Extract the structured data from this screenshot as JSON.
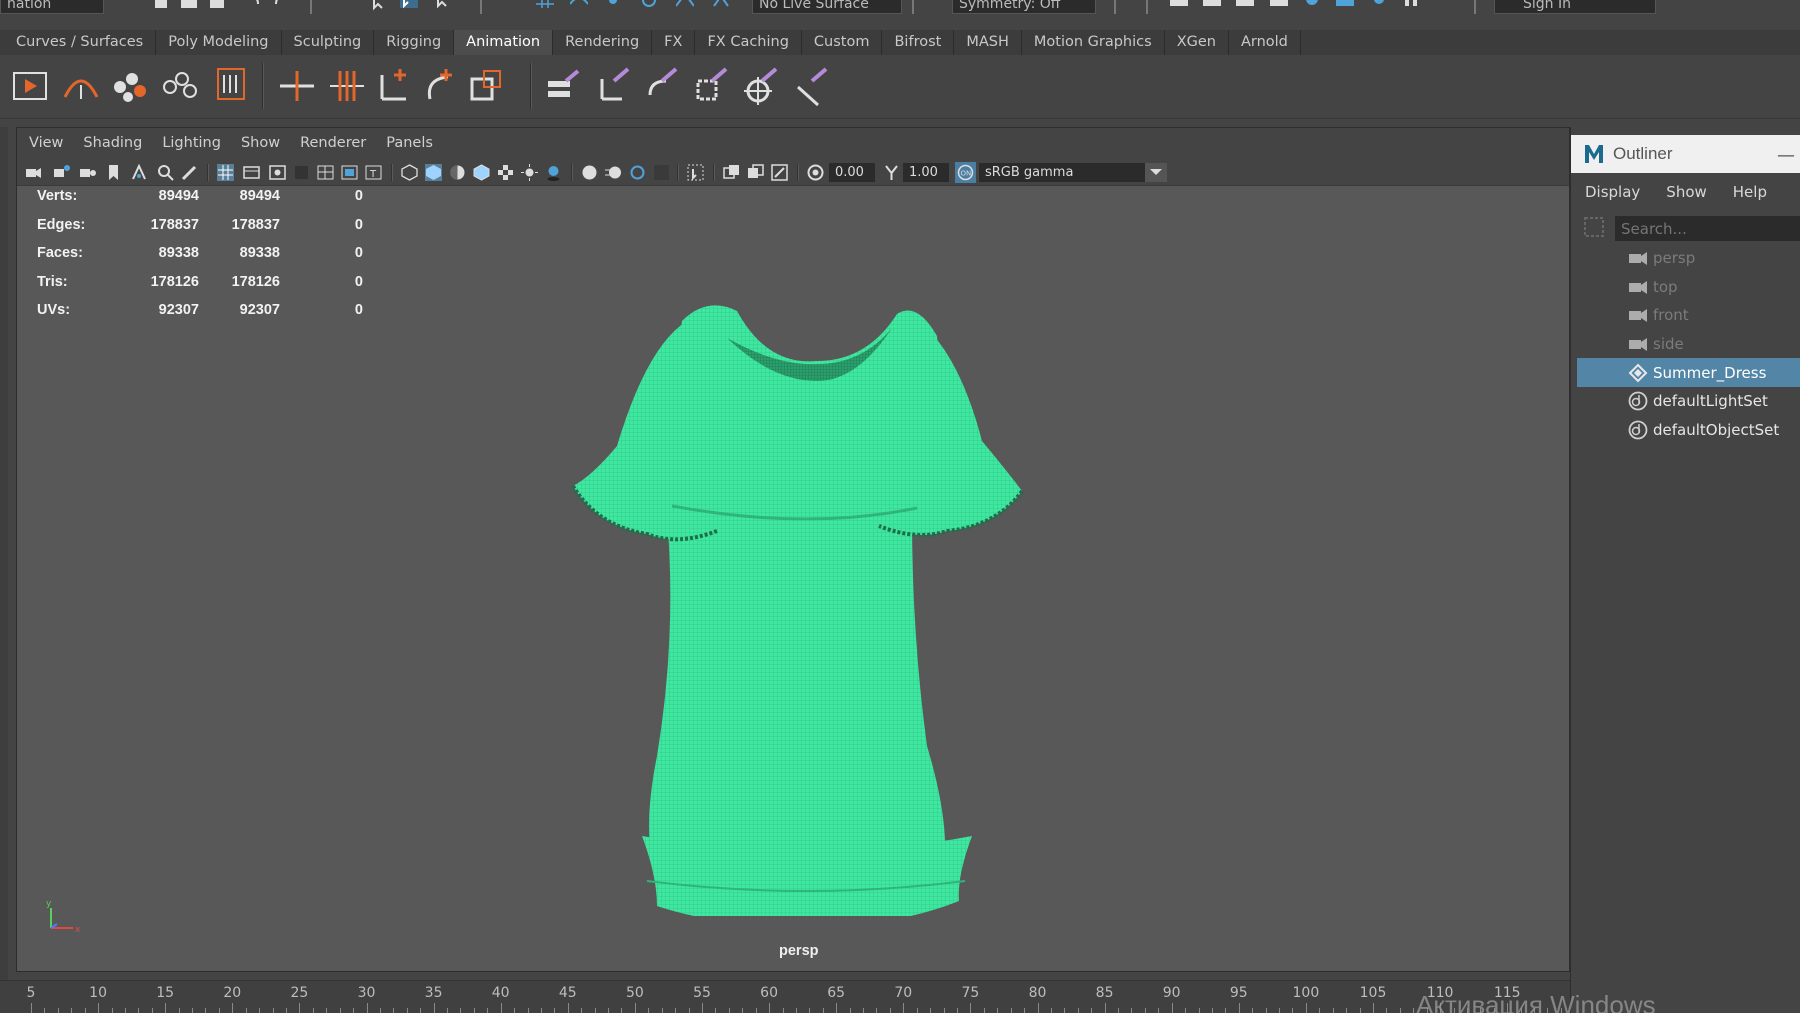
{
  "statusline": {
    "menu_set": "nation",
    "live_surface": "No Live Surface",
    "symmetry": "Symmetry: Off",
    "sign_in": "Sign In"
  },
  "shelf_tabs": [
    {
      "label": "Curves / Surfaces",
      "active": false
    },
    {
      "label": "Poly Modeling",
      "active": false
    },
    {
      "label": "Sculpting",
      "active": false
    },
    {
      "label": "Rigging",
      "active": false
    },
    {
      "label": "Animation",
      "active": true
    },
    {
      "label": "Rendering",
      "active": false
    },
    {
      "label": "FX",
      "active": false
    },
    {
      "label": "FX Caching",
      "active": false
    },
    {
      "label": "Custom",
      "active": false
    },
    {
      "label": "Bifrost",
      "active": false
    },
    {
      "label": "MASH",
      "active": false
    },
    {
      "label": "Motion Graphics",
      "active": false
    },
    {
      "label": "XGen",
      "active": false
    },
    {
      "label": "Arnold",
      "active": false
    }
  ],
  "panel": {
    "menus": [
      "View",
      "Shading",
      "Lighting",
      "Show",
      "Renderer",
      "Panels"
    ],
    "exposure": "0.00",
    "gamma": "1.00",
    "color_space": "sRGB gamma",
    "camera_label": "persp"
  },
  "hud": [
    {
      "label": "Verts:",
      "a": "89494",
      "b": "89494",
      "c": "0"
    },
    {
      "label": "Edges:",
      "a": "178837",
      "b": "178837",
      "c": "0"
    },
    {
      "label": "Faces:",
      "a": "89338",
      "b": "89338",
      "c": "0"
    },
    {
      "label": "Tris:",
      "a": "178126",
      "b": "178126",
      "c": "0"
    },
    {
      "label": "UVs:",
      "a": "92307",
      "b": "92307",
      "c": "0"
    }
  ],
  "timeline": {
    "labels": [
      "5",
      "10",
      "15",
      "20",
      "25",
      "30",
      "35",
      "40",
      "45",
      "50",
      "55",
      "60",
      "65",
      "70",
      "75",
      "80",
      "85",
      "90",
      "95",
      "100",
      "105",
      "110",
      "115"
    ]
  },
  "outliner": {
    "title": "Outliner",
    "menus": [
      "Display",
      "Show",
      "Help"
    ],
    "search_placeholder": "Search...",
    "items": [
      {
        "label": "persp",
        "icon": "camera-icon",
        "state": "dim"
      },
      {
        "label": "top",
        "icon": "camera-icon",
        "state": "dim"
      },
      {
        "label": "front",
        "icon": "camera-icon",
        "state": "dim"
      },
      {
        "label": "side",
        "icon": "camera-icon",
        "state": "dim"
      },
      {
        "label": "Summer_Dress",
        "icon": "transform-icon",
        "state": "selected"
      },
      {
        "label": "defaultLightSet",
        "icon": "set-icon",
        "state": "normal"
      },
      {
        "label": "defaultObjectSet",
        "icon": "set-icon",
        "state": "normal"
      }
    ]
  },
  "watermark": "Активация Windows",
  "colors": {
    "mesh": "#3fe8a0",
    "selection": "#5285a6",
    "active_tab": "#4d4d4d",
    "viewport_bg": "#585858"
  }
}
